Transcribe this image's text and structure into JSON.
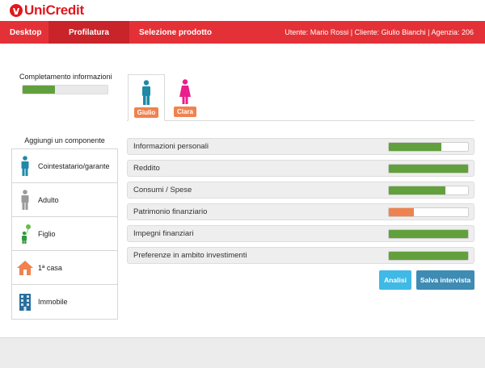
{
  "brand": {
    "logo_text": "UniCredit",
    "color": "#e1171e"
  },
  "nav": {
    "items": [
      {
        "label": "Desktop"
      },
      {
        "label": "Profilatura",
        "active": true
      },
      {
        "label": "Selezione prodotto"
      }
    ],
    "user_info": "Utente: Mario Rossi | Cliente: Giulio Bianchi | Agenzia: 206"
  },
  "completion": {
    "label": "Completamento informazioni",
    "progress": 0.38,
    "color": "#62a03d"
  },
  "persons": [
    {
      "name": "Giulio",
      "icon": "male-person-icon",
      "color": "#1e8aa8",
      "active": true
    },
    {
      "name": "Clara",
      "icon": "female-person-icon",
      "color": "#ea1e8c",
      "active": false
    }
  ],
  "add_component": {
    "title": "Aggiungi un componente",
    "items": [
      {
        "label": "Cointestatario/garante",
        "icon": "cointestatario-icon"
      },
      {
        "label": "Adulto",
        "icon": "adult-icon"
      },
      {
        "label": "Figlio",
        "icon": "child-icon"
      },
      {
        "label": "1ª casa",
        "icon": "house-icon"
      },
      {
        "label": "Immobile",
        "icon": "building-icon"
      }
    ]
  },
  "sections": [
    {
      "label": "Informazioni personali",
      "progress": 0.66,
      "color": "#62a03d"
    },
    {
      "label": "Reddito",
      "progress": 1.0,
      "color": "#62a03d"
    },
    {
      "label": "Consumi / Spese",
      "progress": 0.71,
      "color": "#62a03d"
    },
    {
      "label": "Patrimonio finanziario",
      "progress": 0.32,
      "color": "#f0824f"
    },
    {
      "label": "Impegni finanziari",
      "progress": 1.0,
      "color": "#62a03d"
    },
    {
      "label": "Preferenze in ambito investimenti",
      "progress": 1.0,
      "color": "#62a03d"
    }
  ],
  "buttons": {
    "analisi": "Analisi",
    "salva": "Salva intervista"
  }
}
